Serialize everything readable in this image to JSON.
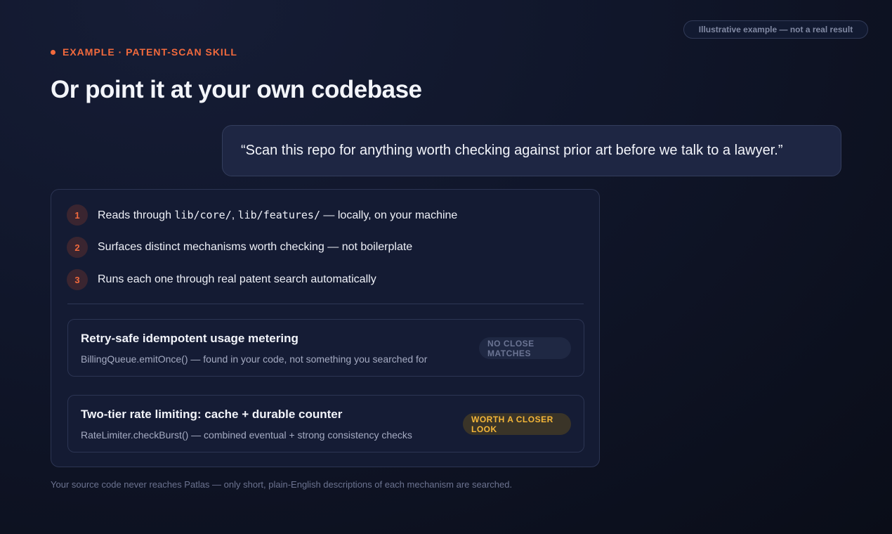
{
  "top_badge": "Illustrative example — not a real result",
  "eyebrow": "EXAMPLE · PATENT-SCAN SKILL",
  "title": "Or point it at your own codebase",
  "quote": "“Scan this repo for anything worth checking against prior art before we talk to a lawyer.”",
  "steps": [
    {
      "num": "1",
      "pre": "Reads through ",
      "code1": "lib/core/",
      "sep": ", ",
      "code2": "lib/features/",
      "post": " — locally, on your machine"
    },
    {
      "num": "2",
      "text": "Surfaces distinct mechanisms worth checking — not boilerplate"
    },
    {
      "num": "3",
      "text": "Runs each one through real patent search automatically"
    }
  ],
  "results": [
    {
      "title": "Retry-safe idempotent usage metering",
      "subtitle": "BillingQueue.emitOnce() — found in your code, not something you searched for",
      "status": "NO CLOSE MATCHES"
    },
    {
      "title": "Two-tier rate limiting: cache + durable counter",
      "subtitle": "RateLimiter.checkBurst() — combined eventual + strong consistency checks",
      "status": "WORTH A CLOSER LOOK"
    }
  ],
  "footnote": "Your source code never reaches Patlas — only short, plain-English descriptions of each mechanism are searched.",
  "colors": {
    "accent": "#f26a3d",
    "warning": "#f5b638",
    "background": "#10162a"
  }
}
